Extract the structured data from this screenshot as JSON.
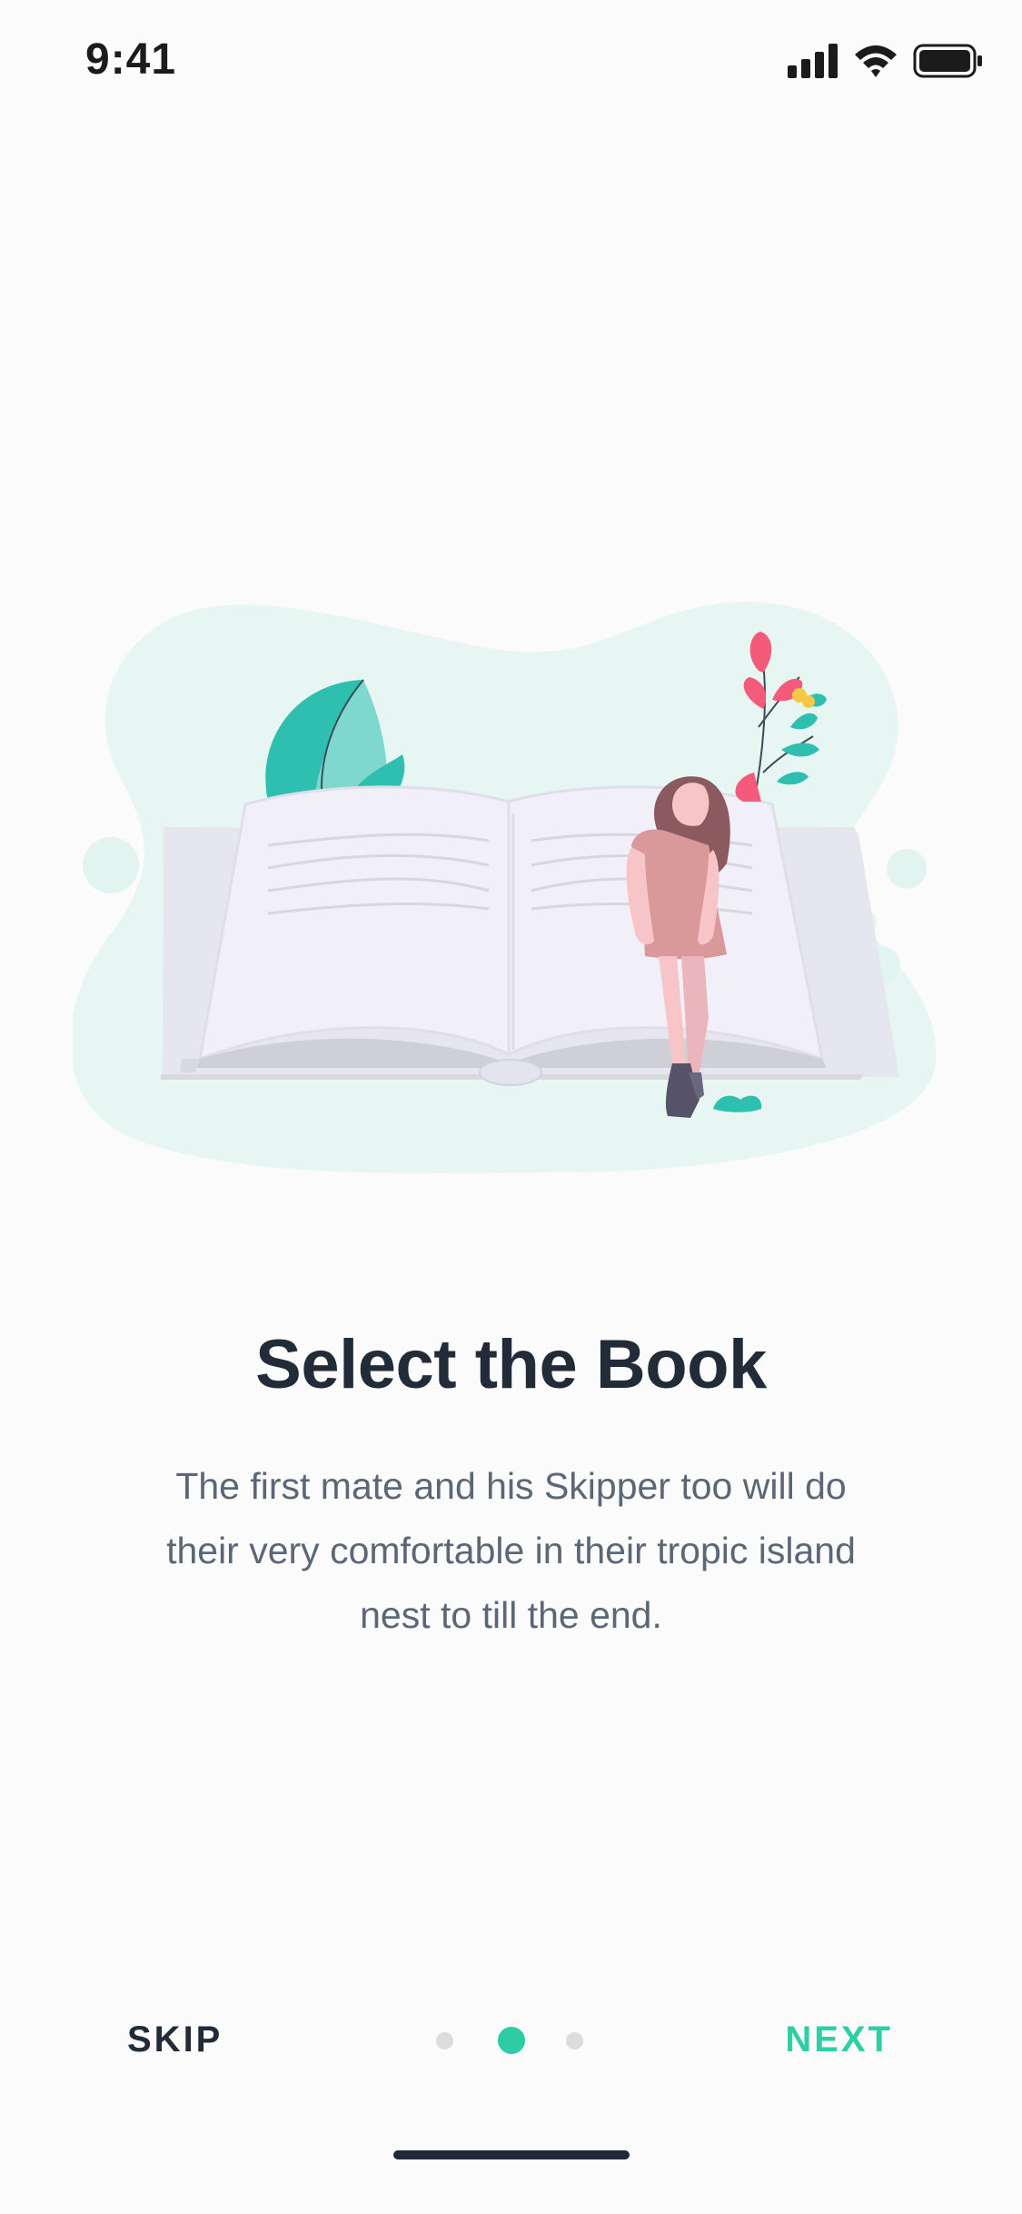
{
  "status_bar": {
    "time": "9:41"
  },
  "onboarding": {
    "title": "Select the Book",
    "description": "The first mate and his Skipper too will do their very comfortable in their tropic island nest to till the end."
  },
  "nav": {
    "skip_label": "SKIP",
    "next_label": "NEXT",
    "page_count": 3,
    "current_page": 2
  },
  "colors": {
    "accent": "#2fcfa6",
    "title": "#222b38",
    "text": "#5b6776",
    "background": "#fbfbfb"
  }
}
